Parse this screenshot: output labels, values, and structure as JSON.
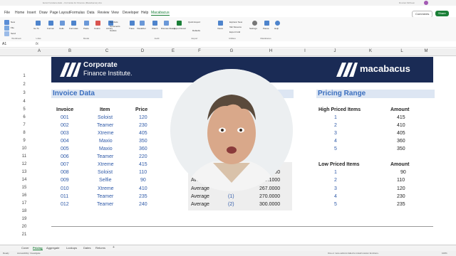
{
  "title_bar": {
    "file_name": "Excel Fundamentals – Formulas for Finance (Macabacus).xlsx",
    "user_name": "Duncan McKeen"
  },
  "menu": {
    "items": [
      "File",
      "Home",
      "Insert",
      "Draw",
      "Page Layout",
      "Formulas",
      "Data",
      "Review",
      "View",
      "Developer",
      "Help",
      "Macabacus"
    ],
    "comments_button": "Comments",
    "share_button": "Share"
  },
  "ribbon": {
    "groups": [
      {
        "label": "Workbook",
        "buttons": [
          "New",
          "File",
          "Send"
        ]
      },
      {
        "label": "Links",
        "buttons": [
          "Go To"
        ]
      },
      {
        "label": "Model",
        "buttons": [
          "Format",
          "Cells",
          "Formulas",
          "Paste",
          "Colors",
          "Library"
        ]
      },
      {
        "label": "Audit",
        "buttons": [
          "Trace",
          "Visualizer",
          "Watch",
          "Discuss Dialog",
          "Symbols",
          "Comments",
          "Guides"
        ]
      },
      {
        "label": "Export",
        "buttons": [
          "Export Excel",
          "Quick Export",
          "Defaults"
        ]
      },
      {
        "label": "Utilities",
        "buttons": [
          "Views",
          "Explorer New",
          "Tab Streams",
          "Export Grid"
        ]
      },
      {
        "label": "Macabacus",
        "buttons": [
          "Settings",
          "Pause",
          "Help"
        ]
      }
    ]
  },
  "formula_bar": {
    "name_box": "A1",
    "fx_label": "fx",
    "formula": ""
  },
  "columns": [
    "A",
    "B",
    "C",
    "D",
    "E",
    "F",
    "G",
    "H",
    "I",
    "J",
    "K",
    "L",
    "M"
  ],
  "rows": [
    1,
    2,
    3,
    4,
    5,
    6,
    7,
    8,
    9,
    10,
    11,
    12,
    13,
    14,
    15,
    16,
    17,
    18,
    19,
    20,
    21
  ],
  "banner": {
    "cfi_line1": "Corporate",
    "cfi_line2": "Finance Institute.",
    "brand": "macabacus"
  },
  "invoice": {
    "title": "Invoice Data",
    "headers": [
      "Invoice",
      "Item",
      "Price"
    ],
    "rows": [
      [
        "001",
        "Soloist",
        "120"
      ],
      [
        "002",
        "Teamer",
        "230"
      ],
      [
        "003",
        "Xtreme",
        "405"
      ],
      [
        "004",
        "Maxio",
        "350"
      ],
      [
        "005",
        "Maxio",
        "360"
      ],
      [
        "006",
        "Teamer",
        "220"
      ],
      [
        "007",
        "Xtreme",
        "415"
      ],
      [
        "008",
        "Soloist",
        "110"
      ],
      [
        "009",
        "Selfie",
        "90"
      ],
      [
        "010",
        "Xtreme",
        "410"
      ],
      [
        "011",
        "Teamer",
        "235"
      ],
      [
        "012",
        "Teamer",
        "240"
      ]
    ]
  },
  "calc": {
    "header_fragment": "unt",
    "rows": [
      {
        "label": "",
        "arg": "",
        "value": "267.0800"
      },
      {
        "label": "Average",
        "arg": "",
        "value": "267.1000"
      },
      {
        "label": "Average",
        "arg": "0",
        "value": "267.0000"
      },
      {
        "label": "Average",
        "arg": "(1)",
        "value": "270.0000"
      },
      {
        "label": "Average",
        "arg": "(2)",
        "value": "300.0000"
      }
    ]
  },
  "pricing_range": {
    "title": "Pricing Range",
    "high_header": "High Priced Items",
    "amount_header": "Amount",
    "high": [
      [
        "1",
        "415"
      ],
      [
        "2",
        "410"
      ],
      [
        "3",
        "405"
      ],
      [
        "4",
        "360"
      ],
      [
        "5",
        "350"
      ]
    ],
    "low_header": "Low Priced Items",
    "low": [
      [
        "1",
        "90"
      ],
      [
        "2",
        "110"
      ],
      [
        "3",
        "120"
      ],
      [
        "4",
        "230"
      ],
      [
        "5",
        "235"
      ]
    ]
  },
  "sheet_tabs": [
    "Cover",
    "Pricing",
    "Aggregate",
    "Lookups",
    "Dates",
    "Returns"
  ],
  "active_tab": "Pricing",
  "status": {
    "ready": "Ready",
    "accessibility": "Accessibility: Investigate",
    "notice": "One or more add-ins failed to install custom functions.",
    "zoom": "100%"
  },
  "colors": {
    "banner_bg": "#1a2b55",
    "accent_blue": "#3b6fbf",
    "excel_green": "#1a7f37"
  }
}
